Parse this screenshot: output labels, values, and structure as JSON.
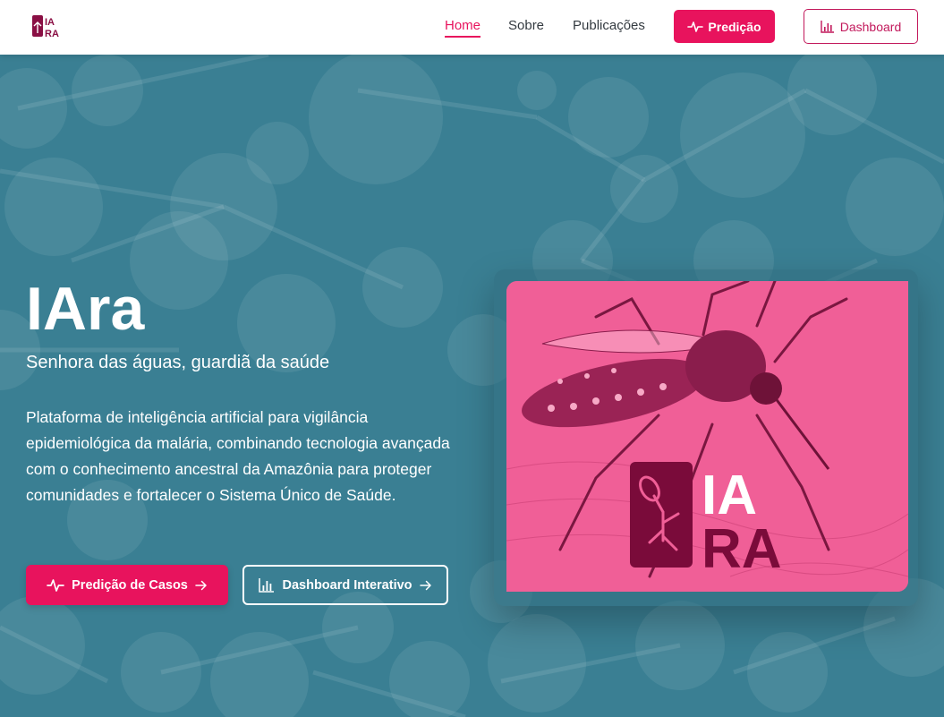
{
  "header": {
    "logo_text": "IARA",
    "nav": [
      {
        "label": "Home",
        "active": true
      },
      {
        "label": "Sobre",
        "active": false
      },
      {
        "label": "Publicações",
        "active": false
      }
    ],
    "predicao_button": "Predição",
    "dashboard_button": "Dashboard"
  },
  "hero": {
    "title": "IAra",
    "subtitle": "Senhora das águas, guardiã da saúde",
    "description": "Plataforma de inteligência artificial para vigilância epidemiológica da malária, combinando tecnologia avançada com o conhecimento ancestral da Amazônia para proteger comunidades e fortalecer o Sistema Único de Saúde.",
    "predicao_cta": "Predição de Casos",
    "dashboard_cta": "Dashboard Interativo",
    "card_logo_line1": "IA",
    "card_logo_line2": "RA"
  },
  "colors": {
    "accent": "#e8135d",
    "hero_bg": "#3a7f93",
    "card_pink": "#f05f97",
    "logo_dark": "#7a0b3a"
  },
  "icons": {
    "activity": "activity-icon",
    "chart": "bar-chart-icon",
    "arrow": "arrow-right-icon",
    "mosquito": "mosquito-icon"
  }
}
